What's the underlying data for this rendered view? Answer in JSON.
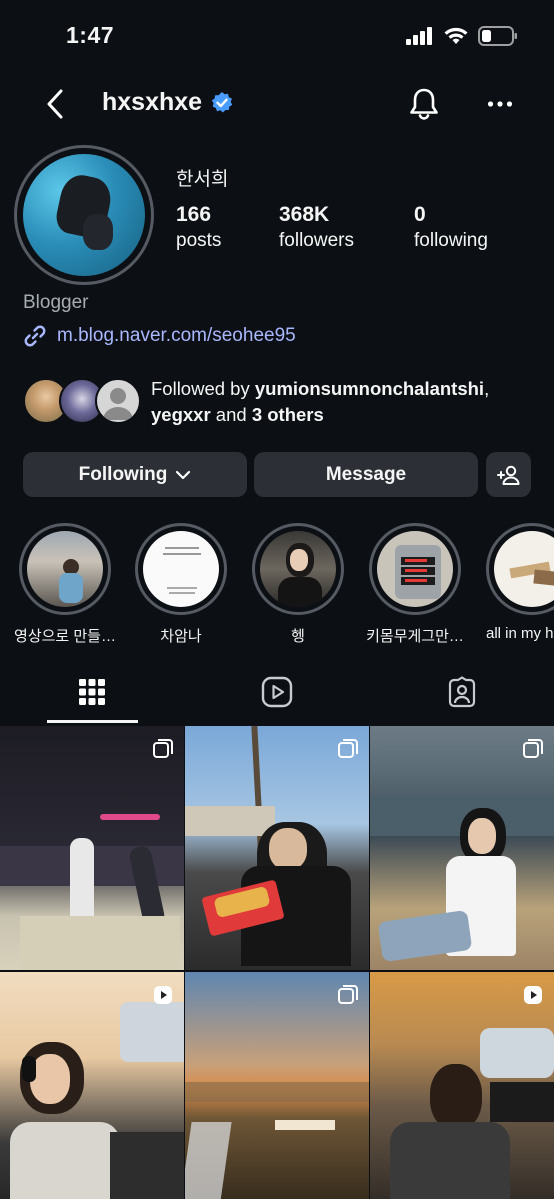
{
  "status_bar": {
    "time": "1:47"
  },
  "header": {
    "username": "hxsxhxe",
    "verified": true
  },
  "profile": {
    "display_name": "한서희",
    "stats": [
      {
        "value": "166",
        "label": "posts"
      },
      {
        "value": "368K",
        "label": "followers"
      },
      {
        "value": "0",
        "label": "following"
      }
    ],
    "category": "Blogger",
    "link": "m.blog.naver.com/seohee95",
    "followed_by": {
      "prefix": "Followed by ",
      "user1": "yumionsumnonchalantshi",
      "comma": ",",
      "user2": "yegxxr",
      "middle": " and ",
      "others": "3 others"
    }
  },
  "actions": {
    "following_label": "Following",
    "message_label": "Message"
  },
  "highlights": [
    {
      "label": "영상으로 만들…"
    },
    {
      "label": "차암나"
    },
    {
      "label": "헹"
    },
    {
      "label": "키몸무게그만…"
    },
    {
      "label": "all in my h"
    }
  ],
  "tabs": [
    {
      "icon": "grid-icon",
      "active": true
    },
    {
      "icon": "reels-icon",
      "active": false
    },
    {
      "icon": "tagged-icon",
      "active": false
    }
  ],
  "grid": [
    {
      "type": "carousel"
    },
    {
      "type": "carousel"
    },
    {
      "type": "carousel"
    },
    {
      "type": "reel"
    },
    {
      "type": "carousel"
    },
    {
      "type": "reel"
    }
  ],
  "colors": {
    "background": "#0c1014",
    "button": "#2c3036",
    "link": "#a9b7ff",
    "verified": "#4a9cff"
  }
}
